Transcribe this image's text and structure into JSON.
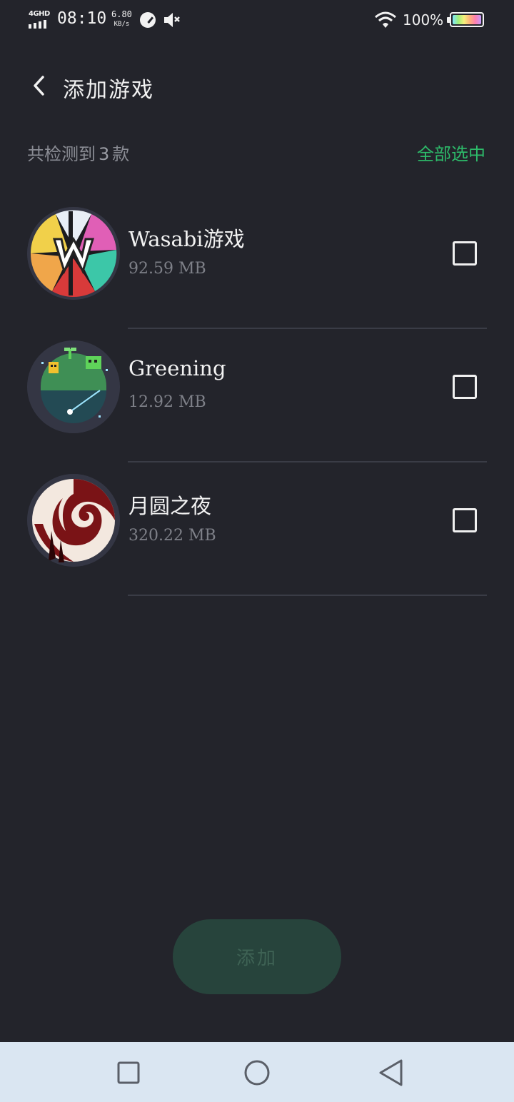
{
  "status_bar": {
    "network": "4GHD",
    "time": "08:10",
    "speed_value": "6.80",
    "speed_unit": "KB/s",
    "battery_pct": "100%"
  },
  "header": {
    "back_icon": "chevron-left-icon",
    "title": "添加游戏"
  },
  "summary": {
    "prefix": "共检测到",
    "count": "3",
    "suffix": "款",
    "select_all": "全部选中"
  },
  "games": [
    {
      "name": "Wasabi游戏",
      "size": "92.59 MB",
      "checked": false
    },
    {
      "name": "Greening",
      "size": "12.92 MB",
      "checked": false
    },
    {
      "name": "月圆之夜",
      "size": "320.22 MB",
      "checked": false
    }
  ],
  "add_button": {
    "label": "添加"
  },
  "nav": {
    "recent": "square-icon",
    "home": "circle-icon",
    "back": "triangle-back-icon"
  },
  "colors": {
    "background": "#23242b",
    "accent": "#2dbb6a",
    "button_disabled": "#27443c",
    "navbar": "#dae6f2"
  }
}
